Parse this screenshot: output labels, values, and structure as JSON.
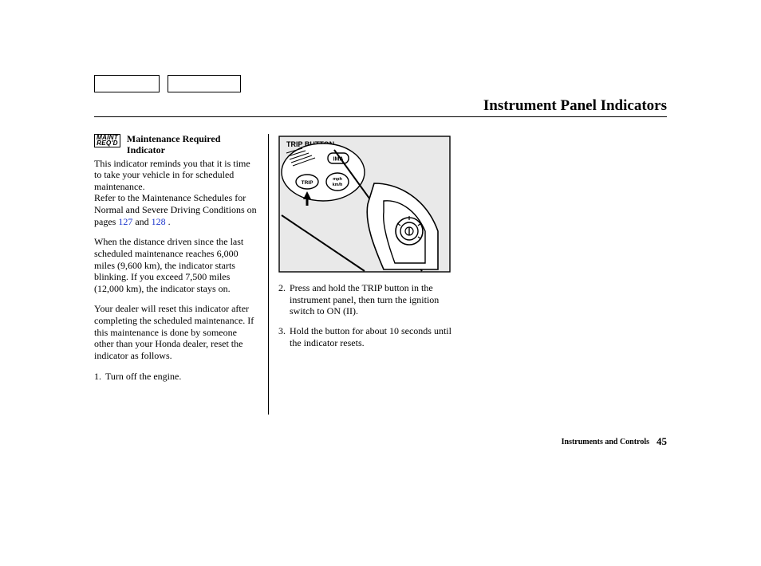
{
  "header": {
    "title": "Instrument Panel Indicators"
  },
  "icon": {
    "line1": "MAINT",
    "line2": "REQ'D"
  },
  "section": {
    "heading_line1": "Maintenance Required",
    "heading_line2": "Indicator"
  },
  "column1": {
    "p1": "This indicator reminds you that it is time to take your vehicle in for scheduled maintenance.",
    "p2a": "Refer to the Maintenance Schedules for Normal and Severe Driving Conditions on pages ",
    "p2_link1": "127",
    "p2_mid": " and ",
    "p2_link2": "128",
    "p2b": " .",
    "p3": "When the distance driven since the last scheduled maintenance reaches 6,000 miles (9,600 km), the indicator starts blinking. If you exceed 7,500 miles (12,000 km), the indicator stays on.",
    "p4": "Your dealer will reset this indicator after completing the scheduled maintenance. If this maintenance is done by someone other than your Honda dealer, reset the indicator as follows.",
    "step1_num": "1.",
    "step1_txt": "Turn off the engine."
  },
  "figure": {
    "caption": "TRIP BUTTON",
    "label_ima": "IMA",
    "label_trip": "TRIP",
    "label_mph": "mph",
    "label_kmh": "km/h"
  },
  "column2": {
    "step2_num": "2.",
    "step2_txt": "Press and hold the TRIP button in the instrument panel, then turn the ignition switch to ON (II).",
    "step3_num": "3.",
    "step3_txt": "Hold the button for about 10 seconds until the indicator resets."
  },
  "footer": {
    "chapter": "Instruments and Controls",
    "page": "45"
  }
}
